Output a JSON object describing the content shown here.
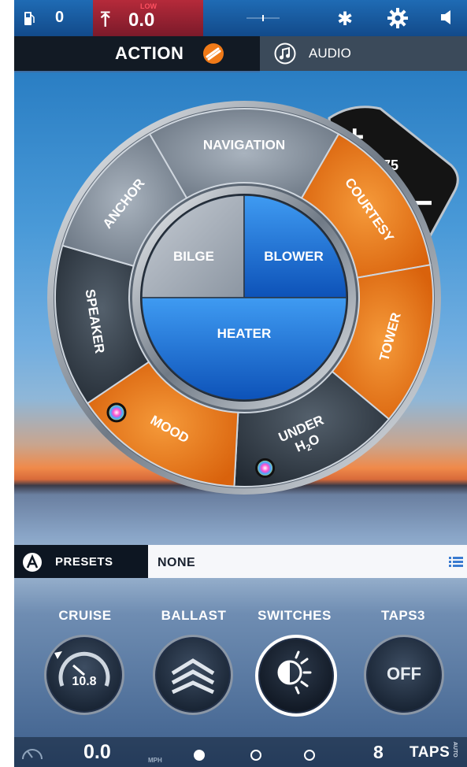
{
  "status_bar": {
    "fuel_icon": "fuel-pump-icon",
    "fuel_value": "0",
    "depth_warning_label": "LOW",
    "depth_value": "0.0",
    "icons": [
      "fuel-pump-icon",
      "anchor-alarm-icon",
      "compass-icon",
      "bluetooth-icon",
      "gear-icon",
      "speaker-icon"
    ]
  },
  "tabs": [
    {
      "label": "ACTION",
      "active": true,
      "icon": "action-logo-icon"
    },
    {
      "label": "AUDIO",
      "active": false,
      "icon": "music-note-icon"
    }
  ],
  "dial": {
    "outer_segments": [
      {
        "label": "NAVIGATION",
        "state": "off"
      },
      {
        "label": "COURTESY",
        "state": "on"
      },
      {
        "label": "TOWER",
        "state": "on"
      },
      {
        "label": "UNDER H2O",
        "line1": "UNDER",
        "line2": "H",
        "sub": "2",
        "line2_end": "O",
        "state": "off",
        "has_color": true
      },
      {
        "label": "MOOD",
        "state": "on",
        "has_color": true
      },
      {
        "label": "SPEAKER",
        "state": "off"
      },
      {
        "label": "ANCHOR",
        "state": "off"
      }
    ],
    "inner_buttons": [
      {
        "label": "BILGE",
        "state": "off"
      },
      {
        "label": "BLOWER",
        "state": "on"
      },
      {
        "label": "HEATER",
        "state": "on"
      }
    ],
    "colors": {
      "on_outer": "#f07a18",
      "off_outer": "#7f8b98",
      "on_inner": "#1a70d8",
      "off_inner": "#a3abb6"
    }
  },
  "volume": {
    "plus": "+",
    "value": "75",
    "minus": "−"
  },
  "presets": {
    "label": "PRESETS",
    "value": "NONE"
  },
  "controls": [
    {
      "label": "CRUISE",
      "value": "10.8",
      "icon": "speedometer-icon"
    },
    {
      "label": "BALLAST",
      "icon": "ballast-chevrons-icon"
    },
    {
      "label": "SWITCHES",
      "icon": "light-switch-icon"
    },
    {
      "label": "TAPS3",
      "value": "OFF"
    }
  ],
  "footer": {
    "speed_value": "0.0",
    "speed_unit": "MPH",
    "taps_count": "8",
    "taps_label": "TAPS",
    "auto_label": "AUTO"
  }
}
